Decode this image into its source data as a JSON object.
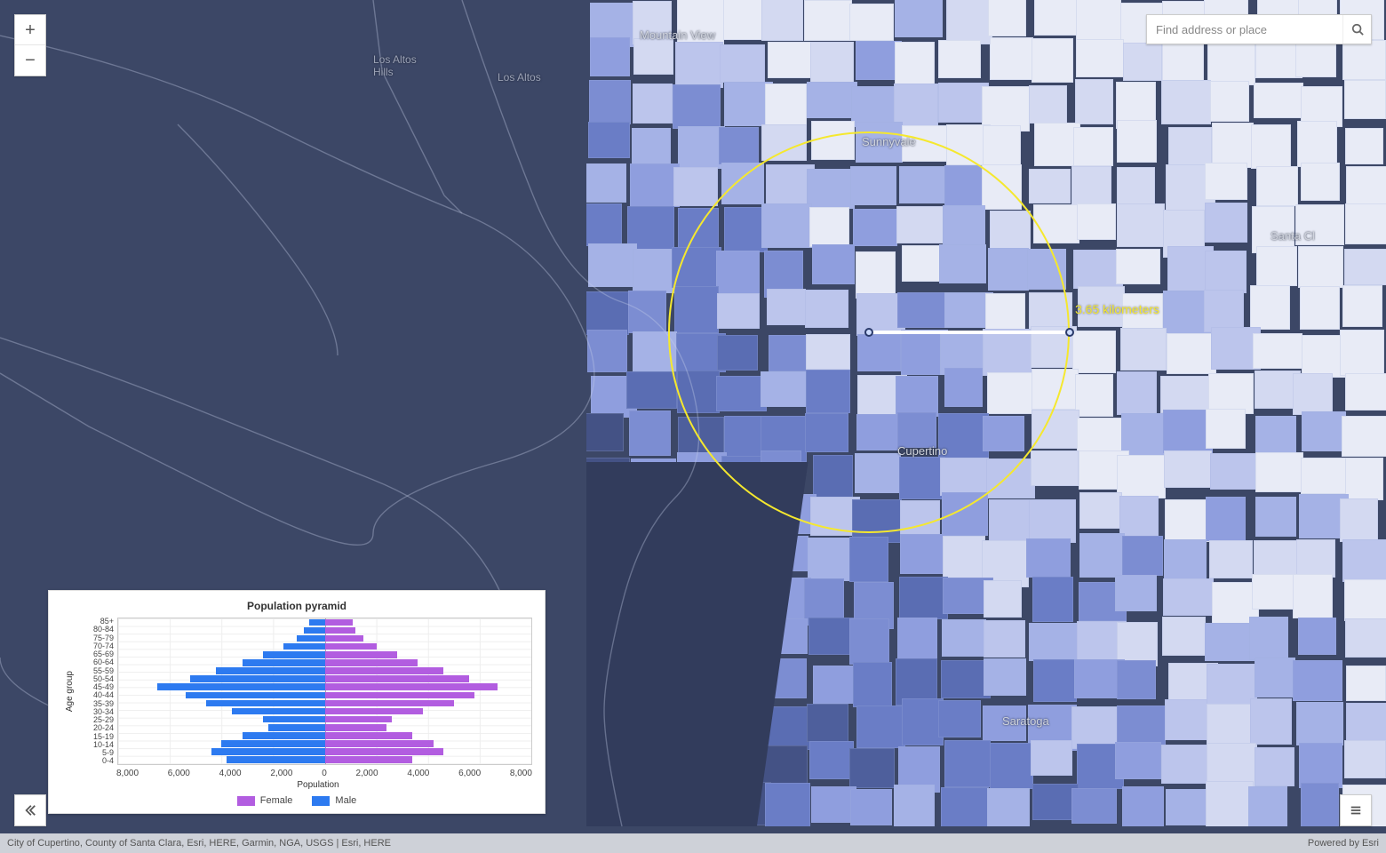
{
  "search": {
    "placeholder": "Find address or place"
  },
  "cities": {
    "mountain_view": "Mountain View",
    "los_altos_hills": "Los Altos\nHills",
    "los_altos": "Los Altos",
    "sunnyvale": "Sunnyvale",
    "cupertino": "Cupertino",
    "santa_clara": "Santa Cl",
    "saratoga": "Saratoga"
  },
  "radius": {
    "label": "3.65 kilometers"
  },
  "attribution": {
    "left": "City of Cupertino, County of Santa Clara, Esri, HERE, Garmin, NGA, USGS | Esri, HERE",
    "right": "Powered by Esri"
  },
  "chart_data": {
    "type": "bar",
    "title": "Population pyramid",
    "xlabel": "Population",
    "ylabel": "Age group",
    "xlim": [
      -8000,
      8000
    ],
    "x_ticks": [
      "8,000",
      "6,000",
      "4,000",
      "2,000",
      "0",
      "2,000",
      "4,000",
      "6,000",
      "8,000"
    ],
    "categories": [
      "85+",
      "80-84",
      "75-79",
      "70-74",
      "65-69",
      "60-64",
      "55-59",
      "50-54",
      "45-49",
      "40-44",
      "35-39",
      "30-34",
      "25-29",
      "20-24",
      "15-19",
      "10-14",
      "5-9",
      "0-4"
    ],
    "series": [
      {
        "name": "Male",
        "values": [
          600,
          800,
          1100,
          1600,
          2400,
          3200,
          4200,
          5200,
          6500,
          5400,
          4600,
          3600,
          2400,
          2200,
          3200,
          4000,
          4400,
          3800
        ]
      },
      {
        "name": "Female",
        "values": [
          1100,
          1200,
          1500,
          2000,
          2800,
          3600,
          4600,
          5600,
          6700,
          5800,
          5000,
          3800,
          2600,
          2400,
          3400,
          4200,
          4600,
          3400
        ]
      }
    ],
    "legend": {
      "female": "Female",
      "male": "Male"
    }
  }
}
